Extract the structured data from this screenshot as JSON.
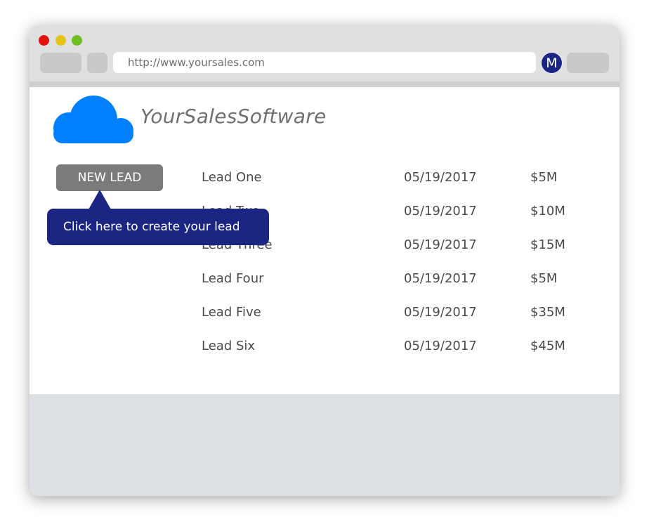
{
  "browser": {
    "url": "http://www.yoursales.com",
    "profile_initial": "M"
  },
  "app": {
    "brand": "YourSalesSoftware",
    "new_lead_label": "NEW LEAD",
    "tooltip_text": "Click here to create your lead"
  },
  "leads": [
    {
      "name": "Lead One",
      "date": "05/19/2017",
      "amount": "$5M"
    },
    {
      "name": "Lead Two",
      "date": "05/19/2017",
      "amount": "$10M"
    },
    {
      "name": "Lead Three",
      "date": "05/19/2017",
      "amount": "$15M"
    },
    {
      "name": "Lead Four",
      "date": "05/19/2017",
      "amount": "$5M"
    },
    {
      "name": "Lead Five",
      "date": "05/19/2017",
      "amount": "$35M"
    },
    {
      "name": "Lead Six",
      "date": "05/19/2017",
      "amount": "$45M"
    }
  ],
  "colors": {
    "accent": "#1b2582",
    "cloud": "#0080ff",
    "button": "#7b7b7b"
  },
  "icons": {
    "logo": "cloud-icon",
    "profile": "avatar"
  }
}
